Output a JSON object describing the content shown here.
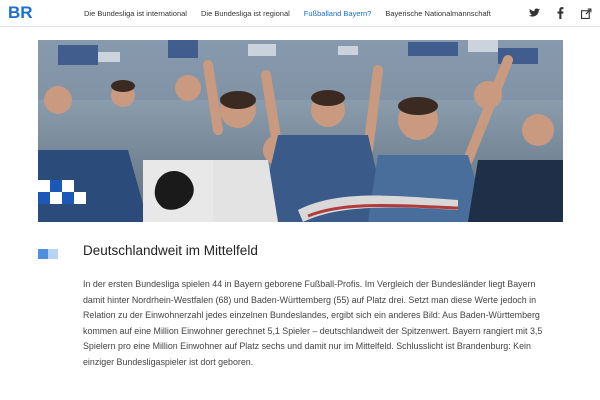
{
  "header": {
    "logo_text": "BR",
    "brand_color": "#1a6fd0",
    "nav": [
      {
        "label": "Die Bundesliga ist international",
        "active": false
      },
      {
        "label": "Die Bundesliga ist regional",
        "active": false
      },
      {
        "label": "Fußballand Bayern?",
        "active": true
      },
      {
        "label": "Bayerische Nationalmannschaft",
        "active": false
      }
    ],
    "social_icons": [
      "twitter-icon",
      "facebook-icon",
      "share-icon"
    ]
  },
  "hero": {
    "description": "Crowd of football fans cheering in a stadium"
  },
  "article": {
    "heading": "Deutschlandweit im Mittelfeld",
    "body": "In der ersten Bundesliga spielen 44 in Bayern geborene Fußball-Profis. Im Vergleich der Bundesländer liegt Bayern damit hinter Nordrhein-Westfalen (68) und Baden-Württemberg (55) auf Platz drei. Setzt man diese Werte jedoch in Relation zu der Einwohnerzahl jedes einzelnen Bundeslandes, ergibt sich ein anderes Bild: Aus Baden-Württemberg kommen auf eine Million Einwohner gerechnet 5,1 Spieler – deutschlandweit der Spitzenwert. Bayern rangiert mit 3,5 Spielern pro eine Million Einwohner auf Platz sechs und damit nur im Mittelfeld. Schlusslicht ist Brandenburg: Kein einziger Bundesligaspieler ist dort geboren."
  }
}
